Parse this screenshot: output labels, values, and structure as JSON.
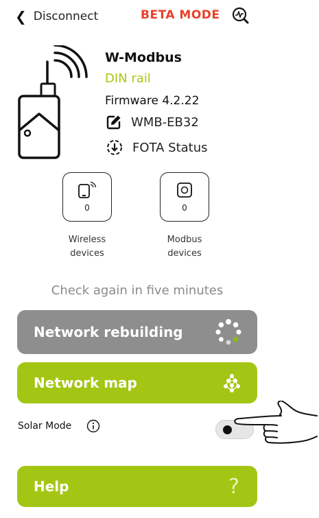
{
  "header": {
    "back_label": "Disconnect",
    "mode_label": "BETA MODE",
    "mode_color": "#e8402b",
    "mode_icon": "beta-inspect-icon"
  },
  "device": {
    "name": "W-Modbus",
    "type": "DIN rail",
    "firmware": "Firmware 4.2.22",
    "model": "WMB-EB32",
    "fota_label": "FOTA Status"
  },
  "counters": {
    "wireless": {
      "value": "0",
      "caption_line1": "Wireless",
      "caption_line2": "devices",
      "icon": "wireless-device-icon"
    },
    "modbus": {
      "value": "0",
      "caption_line1": "Modbus",
      "caption_line2": "devices",
      "icon": "modbus-device-icon"
    }
  },
  "status_message": "Check again in five minutes",
  "buttons": {
    "rebuild_label": "Network rebuilding",
    "map_label": "Network map",
    "help_label": "Help",
    "help_symbol": "?"
  },
  "solar": {
    "label": "Solar Mode",
    "enabled": false
  },
  "colors": {
    "accent_green": "#a3c615",
    "disabled_gray": "#8e8e8e",
    "type_green": "#a6c90f"
  }
}
